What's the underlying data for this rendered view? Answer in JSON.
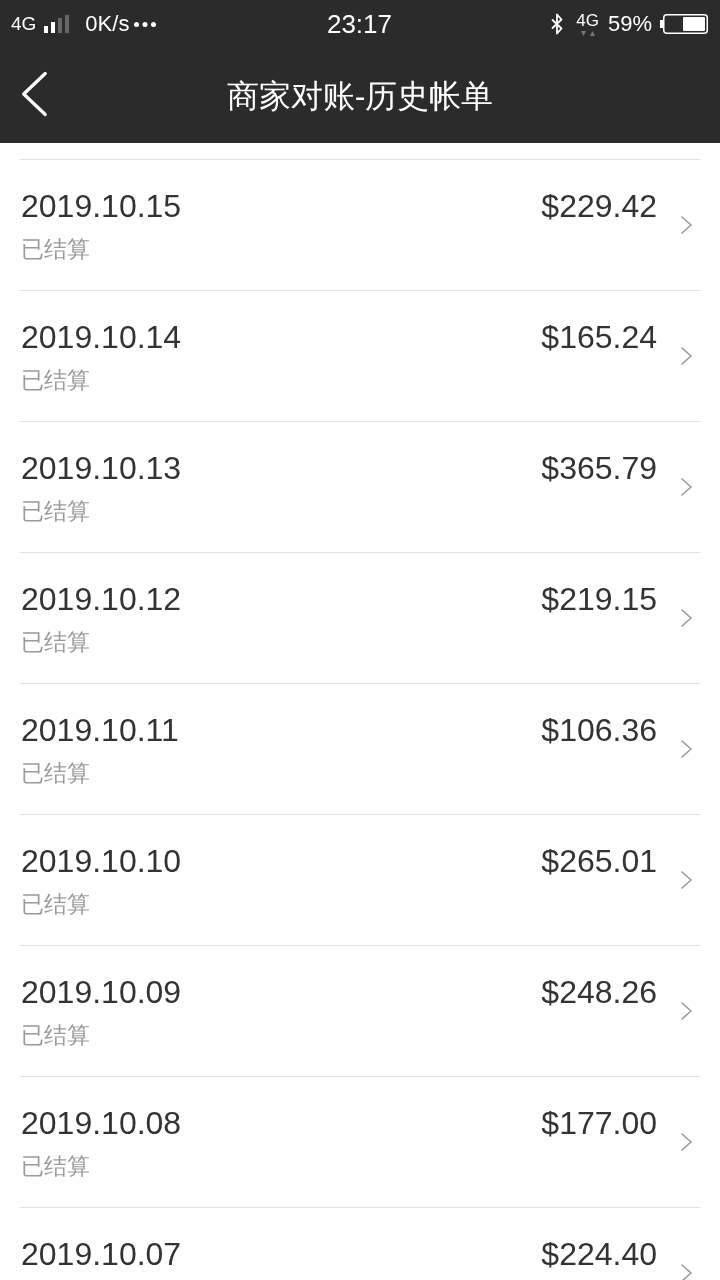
{
  "status_bar": {
    "network_left": "4G",
    "speed": "0K/s",
    "time": "23:17",
    "network_right": "4G",
    "battery": "59%"
  },
  "header": {
    "title": "商家对账-历史帐单"
  },
  "bills": [
    {
      "date": "2019.10.15",
      "amount": "$229.42",
      "status": "已结算"
    },
    {
      "date": "2019.10.14",
      "amount": "$165.24",
      "status": "已结算"
    },
    {
      "date": "2019.10.13",
      "amount": "$365.79",
      "status": "已结算"
    },
    {
      "date": "2019.10.12",
      "amount": "$219.15",
      "status": "已结算"
    },
    {
      "date": "2019.10.11",
      "amount": "$106.36",
      "status": "已结算"
    },
    {
      "date": "2019.10.10",
      "amount": "$265.01",
      "status": "已结算"
    },
    {
      "date": "2019.10.09",
      "amount": "$248.26",
      "status": "已结算"
    },
    {
      "date": "2019.10.08",
      "amount": "$177.00",
      "status": "已结算"
    },
    {
      "date": "2019.10.07",
      "amount": "$224.40"
    }
  ]
}
